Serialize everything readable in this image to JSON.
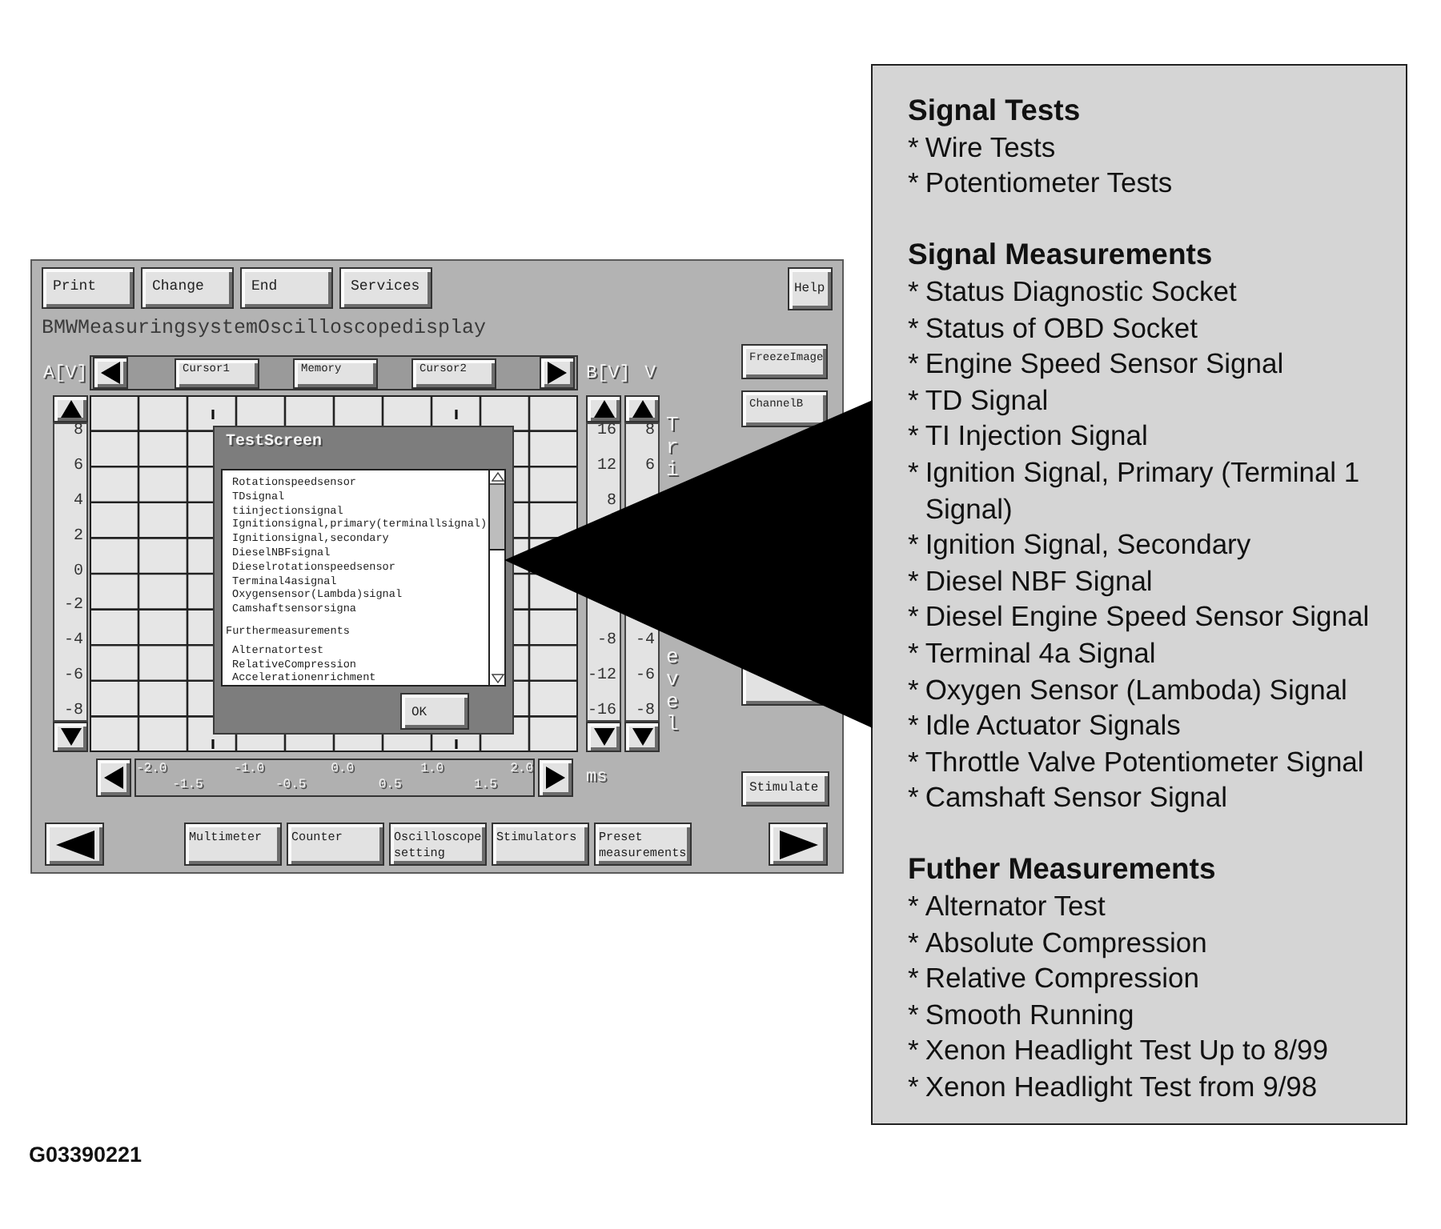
{
  "screen": {
    "toolbar": [
      "Print",
      "Change",
      "End",
      "Services"
    ],
    "help": "Help",
    "title": "BMWMeasuringsystemOscilloscopedisplay",
    "channel_a": {
      "label": "A[V]",
      "ticks": [
        "8",
        "6",
        "4",
        "2",
        "0",
        "-2",
        "-4",
        "-6",
        "-8"
      ]
    },
    "cursor_bar": [
      "Cursor1",
      "Memory",
      "Cursor2"
    ],
    "channel_b": {
      "label": "B[V]",
      "ticks_upper": [
        "16",
        "12",
        "8"
      ],
      "ticks_lower": [
        "-8",
        "-12",
        "-16"
      ]
    },
    "trigger_level": {
      "label": "V",
      "ticks_upper": [
        "8",
        "6"
      ],
      "ticks_lower": [
        "-4",
        "-6",
        "-8"
      ],
      "caption_upper": "Tri",
      "caption_lower": "evel"
    },
    "time_axis": {
      "unit": "ms",
      "ticks_major": [
        "-2.0",
        "-1.0",
        "0.0",
        "1.0",
        "2.0"
      ],
      "ticks_minor": [
        "-1.5",
        "-0.5",
        "0.5",
        "1.5"
      ]
    },
    "side_buttons": [
      "FreezeImage",
      "ChannelB"
    ],
    "stimulate": "Stimulate",
    "function_buttons": [
      "Multimeter",
      "Counter",
      "Oscilloscope setting",
      "Stimulators",
      "Preset measurements"
    ],
    "dialog": {
      "title": "TestScreen",
      "groups": [
        {
          "items": [
            "Rotationspeedsensor",
            "TDsignal",
            "tiinjectionsignal",
            "Ignitionsignal,primary(terminallsignal)",
            "Ignitionsignal,secondary",
            "DieselNBFsignal",
            "Dieselrotationspeedsensor",
            "Terminal4asignal",
            "Oxygensensor(Lambda)signal",
            "Camshaftsensorsigna"
          ]
        },
        {
          "heading": "Furthermeasurements",
          "items": [
            "Alternatortest",
            "RelativeCompression",
            "Accelerationenrichment"
          ]
        }
      ],
      "ok": "OK"
    }
  },
  "notes": {
    "sections": [
      {
        "heading": "Signal Tests",
        "items": [
          {
            "bullet": "*",
            "text": "Wire Tests"
          },
          {
            "bullet": "*",
            "text": "Potentiometer Tests"
          }
        ]
      },
      {
        "heading": "Signal Measurements",
        "items": [
          {
            "bullet": "*",
            "text": "Status Diagnostic Socket"
          },
          {
            "bullet": "*",
            "text": "Status of OBD Socket"
          },
          {
            "bullet": "*",
            "text": "Engine Speed Sensor Signal"
          },
          {
            "bullet": "*",
            "text": "TD Signal"
          },
          {
            "bullet": "*",
            "text": "TI Injection Signal"
          },
          {
            "bullet": "*",
            "text": "Ignition Signal, Primary (Terminal 1 Signal)"
          },
          {
            "bullet": "*",
            "text": "Ignition Signal, Secondary"
          },
          {
            "bullet": "*",
            "text": "Diesel NBF Signal"
          },
          {
            "bullet": "*",
            "text": "Diesel Engine Speed Sensor Signal"
          },
          {
            "bullet": "*",
            "text": "Terminal 4a Signal"
          },
          {
            "bullet": "*",
            "text": "Oxygen Sensor (Lamboda) Signal"
          },
          {
            "bullet": "*",
            "text": "Idle Actuator Signals"
          },
          {
            "bullet": "*",
            "text": "Throttle Valve Potentiometer Signal"
          },
          {
            "bullet": "*",
            "text": "Camshaft Sensor Signal"
          }
        ]
      },
      {
        "heading": "Futher Measurements",
        "items": [
          {
            "bullet": "*",
            "text": "Alternator Test"
          },
          {
            "bullet": "*",
            "text": "Absolute Compression"
          },
          {
            "bullet": "*",
            "text": "Relative Compression"
          },
          {
            "bullet": "*",
            "text": "Smooth Running"
          },
          {
            "bullet": "*",
            "text": "Xenon Headlight Test Up to 8/99"
          },
          {
            "bullet": "*",
            "text": "Xenon Headlight Test from 9/98"
          }
        ]
      }
    ]
  },
  "figure_code": "G03390221"
}
